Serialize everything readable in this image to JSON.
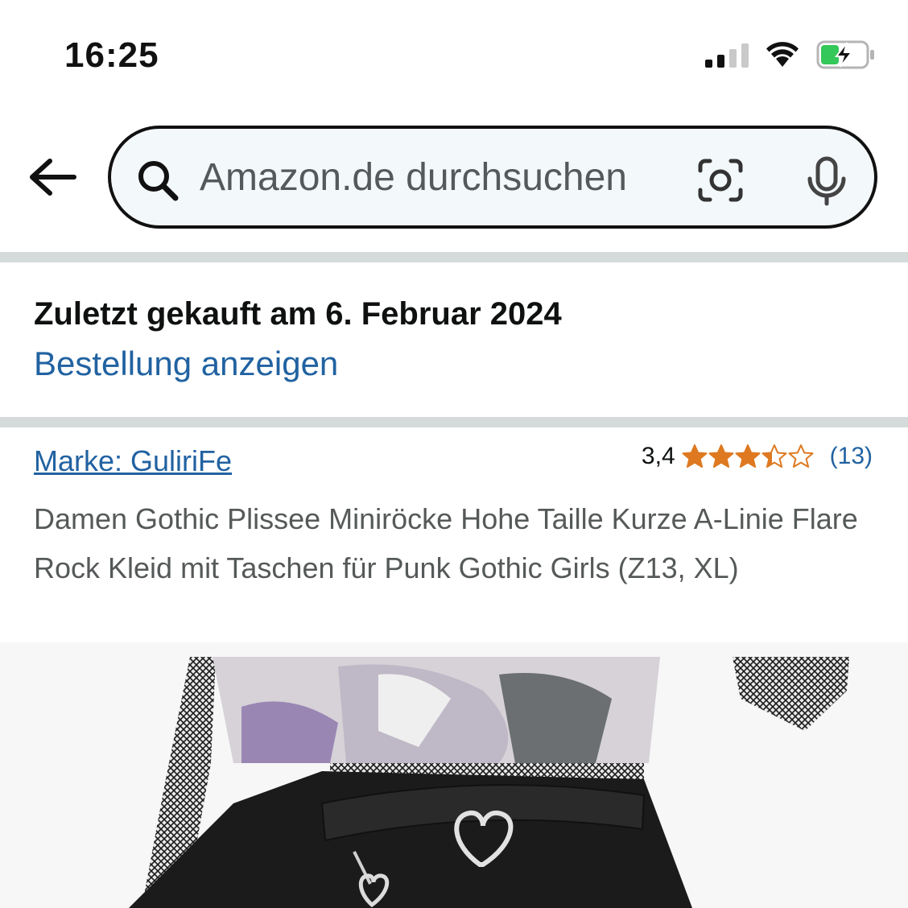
{
  "status_bar": {
    "time": "16:25"
  },
  "search": {
    "placeholder": "Amazon.de durchsuchen"
  },
  "purchase": {
    "title": "Zuletzt gekauft am 6. Februar 2024",
    "link_label": "Bestellung anzeigen"
  },
  "product": {
    "brand": "Marke: GuliriFe",
    "rating_value": "3,4",
    "rating_stars": 3.4,
    "rating_count": "(13)",
    "title": "Damen Gothic Plissee Miniröcke Hohe Taille Kurze A-Linie Flare Rock Kleid mit Taschen für Punk Gothic Girls (Z13, XL)"
  },
  "colors": {
    "link": "#2162a1",
    "star": "#de7921",
    "divider": "#d5dbdb"
  },
  "icons": [
    "back-arrow-icon",
    "search-icon",
    "camera-icon",
    "microphone-icon",
    "signal-icon",
    "wifi-icon",
    "battery-charging-icon"
  ]
}
